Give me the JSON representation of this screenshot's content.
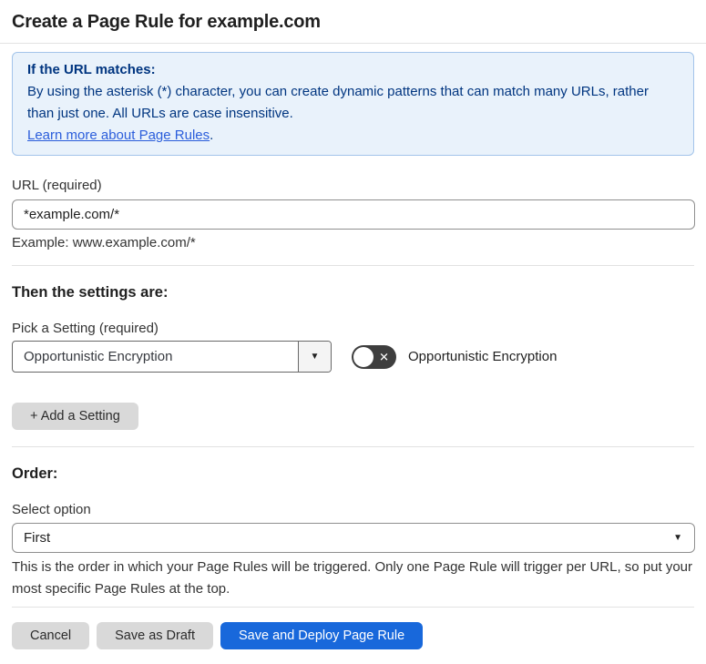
{
  "page": {
    "title": "Create a Page Rule for example.com"
  },
  "info_box": {
    "heading": "If the URL matches:",
    "body": "By using the asterisk (*) character, you can create dynamic patterns that can match many URLs, rather than just one. All URLs are case insensitive.",
    "link_label": "Learn more about Page Rules",
    "link_suffix": "."
  },
  "url_field": {
    "label": "URL (required)",
    "value": "*example.com/*",
    "helper": "Example: www.example.com/*"
  },
  "settings_section": {
    "heading": "Then the settings are:",
    "picker_label": "Pick a Setting (required)",
    "selected_setting": "Opportunistic Encryption",
    "toggle_state": "off",
    "toggle_label": "Opportunistic Encryption",
    "add_setting_label": "+ Add a Setting"
  },
  "order_section": {
    "heading": "Order:",
    "select_label": "Select option",
    "selected_option": "First",
    "helper": "This is the order in which your Page Rules will be triggered. Only one Page Rule will trigger per URL, so put your most specific Page Rules at the top."
  },
  "footer": {
    "cancel_label": "Cancel",
    "save_draft_label": "Save as Draft",
    "deploy_label": "Save and Deploy Page Rule"
  },
  "icons": {
    "dropdown_caret": "▼",
    "toggle_off_glyph": "✕"
  },
  "colors": {
    "info_box_background": "#e9f2fb",
    "info_box_border": "#a3c4ea",
    "info_box_text": "#003580",
    "link_blue": "#2a5ddb",
    "primary_button_blue": "#1868db",
    "gray_button": "#d9d9d9",
    "toggle_off_background": "#3e3e3e",
    "divider": "#e2e2e2",
    "input_border": "#8f8f8f"
  }
}
